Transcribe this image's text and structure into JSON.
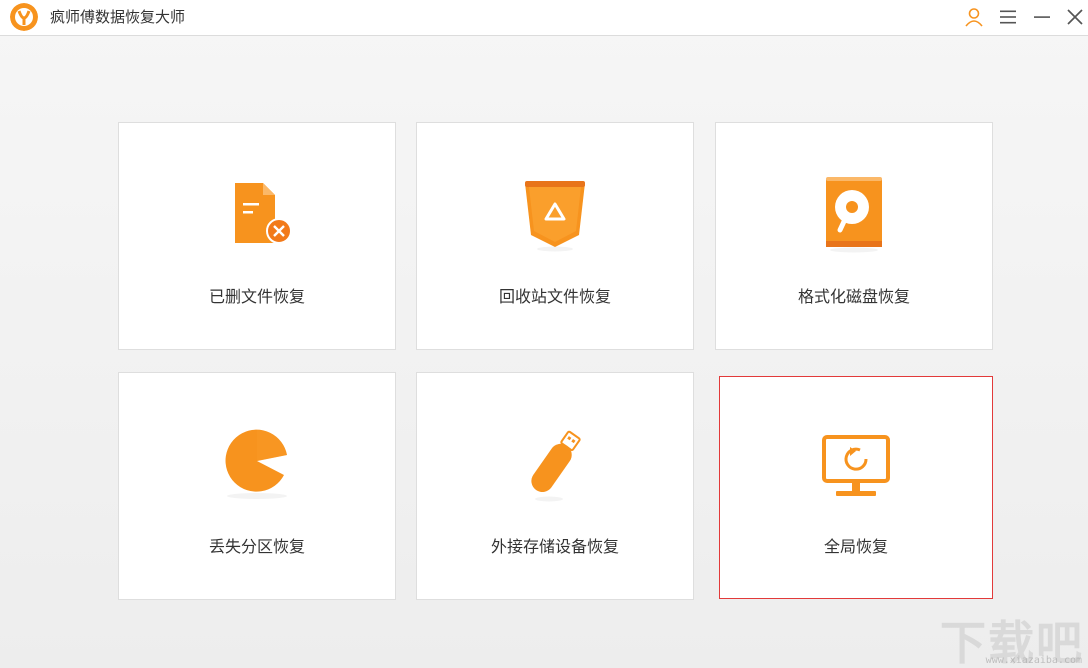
{
  "app": {
    "title": "疯师傅数据恢复大师"
  },
  "titlebar_buttons": {
    "user": "user",
    "menu": "menu",
    "minimize": "minimize",
    "close": "close"
  },
  "cards": [
    {
      "id": "deleted",
      "label": "已删文件恢复",
      "icon": "deleted-file-icon"
    },
    {
      "id": "recycle",
      "label": "回收站文件恢复",
      "icon": "recycle-bin-icon"
    },
    {
      "id": "format",
      "label": "格式化磁盘恢复",
      "icon": "formatted-disk-icon"
    },
    {
      "id": "partition",
      "label": "丢失分区恢复",
      "icon": "lost-partition-icon"
    },
    {
      "id": "external",
      "label": "外接存储设备恢复",
      "icon": "usb-drive-icon"
    },
    {
      "id": "global",
      "label": "全局恢复",
      "icon": "monitor-restore-icon",
      "selected": true
    }
  ],
  "colors": {
    "accent": "#f7931e",
    "accent_dark": "#e8741a",
    "selected_border": "#e23a3a"
  },
  "watermark": {
    "main": "下载吧",
    "sub": "www.xiazaiba.com"
  }
}
